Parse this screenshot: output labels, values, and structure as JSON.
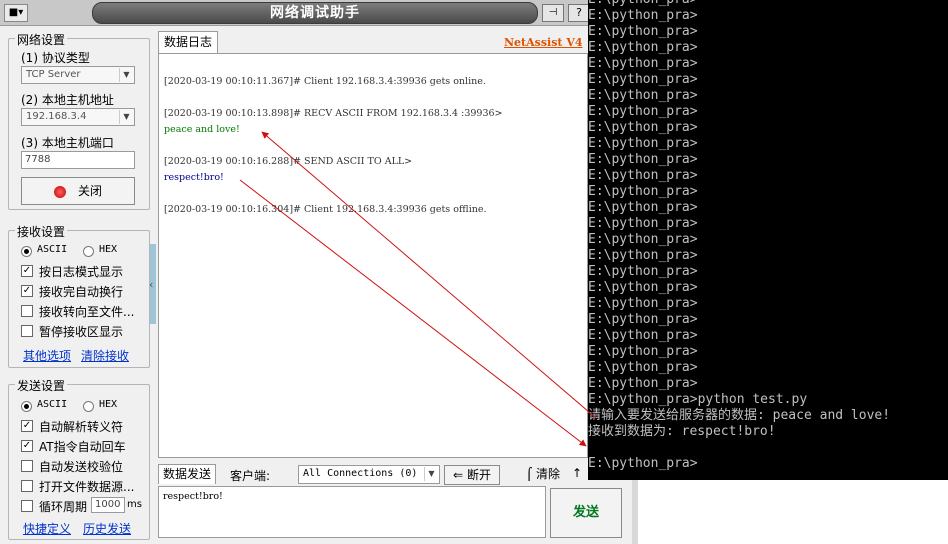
{
  "window": {
    "title": "网络调试助手",
    "brand": "NetAssist V4"
  },
  "network_settings": {
    "group_title": "网络设置",
    "protocol_label": "(1) 协议类型",
    "protocol_value": "TCP Server",
    "host_label": "(2) 本地主机地址",
    "host_value": "192.168.3.4",
    "port_label": "(3) 本地主机端口",
    "port_value": "7788",
    "close_button": "关闭"
  },
  "receive_settings": {
    "group_title": "接收设置",
    "ascii_label": "ASCII",
    "hex_label": "HEX",
    "options": [
      {
        "label": "按日志模式显示",
        "checked": true
      },
      {
        "label": "接收完自动换行",
        "checked": true
      },
      {
        "label": "接收转向至文件...",
        "checked": false
      },
      {
        "label": "暂停接收区显示",
        "checked": false
      }
    ],
    "more_options_link": "其他选项",
    "clear_receive_link": "清除接收"
  },
  "send_settings": {
    "group_title": "发送设置",
    "ascii_label": "ASCII",
    "hex_label": "HEX",
    "options": [
      {
        "label": "自动解析转义符",
        "checked": true
      },
      {
        "label": "AT指令自动回车",
        "checked": true
      },
      {
        "label": "自动发送校验位",
        "checked": false
      },
      {
        "label": "打开文件数据源...",
        "checked": false
      }
    ],
    "loop_label": "循环周期",
    "loop_value": "1000",
    "loop_unit": "ms",
    "shortcut_link": "快捷定义",
    "history_link": "历史发送"
  },
  "log": {
    "tab_label": "数据日志",
    "lines": [
      {
        "text": "[2020-03-19 00:10:11.367]# Client 192.168.3.4:39936 gets online.",
        "color": "#333333"
      },
      {
        "text": "[2020-03-19 00:10:13.898]# RECV ASCII FROM 192.168.3.4 :39936>",
        "color": "#333333"
      },
      {
        "text": "peace and love!",
        "color": "#007a00"
      },
      {
        "text": "[2020-03-19 00:10:16.288]# SEND ASCII TO ALL>",
        "color": "#333333"
      },
      {
        "text": "respect!bro!",
        "color": "#00008b"
      },
      {
        "text": "[2020-03-19 00:10:16.304]# Client 192.168.3.4:39936 gets offline.",
        "color": "#333333"
      }
    ]
  },
  "send_area": {
    "tab_label": "数据发送",
    "client_label": "客户端:",
    "client_value": "All Connections (0)",
    "disconnect_button": "断开",
    "clear_button": "清除",
    "input_value": "respect!bro!",
    "send_button": "发送"
  },
  "console": {
    "prompt_lines": 25,
    "prompt": "E:\\python_pra>",
    "command_line": "E:\\python_pra>python test.py",
    "input_prompt_line": "请输入要发送给服务器的数据: peace and love!",
    "received_line": "接收到数据为:  respect!bro!",
    "final_prompt": "E:\\python_pra>"
  },
  "colors": {
    "arrow": "#d01010",
    "console_bg": "#000000",
    "console_fg": "#c0c0c0"
  }
}
